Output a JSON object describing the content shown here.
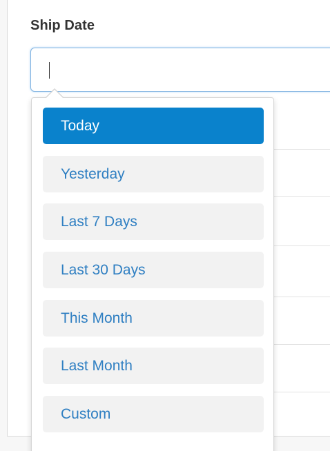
{
  "field": {
    "label": "Ship Date",
    "value": "",
    "placeholder": ""
  },
  "dropdown": {
    "options": [
      {
        "label": "Today",
        "active": true
      },
      {
        "label": "Yesterday",
        "active": false
      },
      {
        "label": "Last 7 Days",
        "active": false
      },
      {
        "label": "Last 30 Days",
        "active": false
      },
      {
        "label": "This Month",
        "active": false
      },
      {
        "label": "Last Month",
        "active": false
      },
      {
        "label": "Custom",
        "active": false
      }
    ]
  },
  "colors": {
    "active_bg": "#0a82cc",
    "active_text": "#ffffff",
    "option_bg": "#f2f2f2",
    "option_text": "#2f7fc2",
    "input_focus_border": "#7fb2e0",
    "label_text": "#333333"
  }
}
